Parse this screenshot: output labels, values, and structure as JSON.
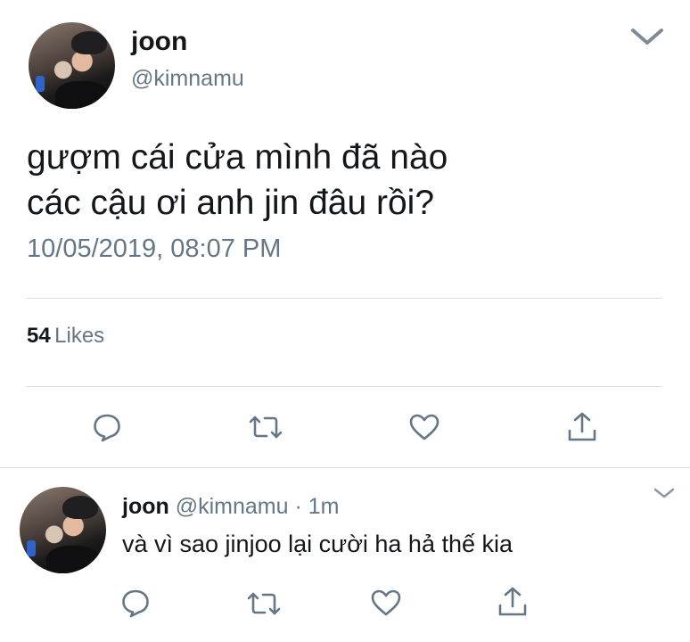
{
  "main_tweet": {
    "display_name": "joon",
    "handle": "@kimnamu",
    "text_line1": "gượm cái cửa mình đã nào",
    "text_line2": "các cậu ơi anh jin đâu rồi?",
    "timestamp": "10/05/2019, 08:07 PM",
    "likes_count": "54",
    "likes_label": "Likes"
  },
  "reply_tweet": {
    "display_name": "joon",
    "handle": "@kimnamu",
    "separator": "·",
    "time_ago": "1m",
    "text": "và vì sao jinjoo lại cười ha hả thế kia"
  },
  "icons": {
    "reply": "reply-icon",
    "retweet": "retweet-icon",
    "like": "heart-icon",
    "share": "share-icon",
    "menu": "chevron-down-icon"
  },
  "colors": {
    "text_primary": "#14171a",
    "text_secondary": "#657786",
    "icon": "#657786",
    "divider": "#d6dde3"
  }
}
